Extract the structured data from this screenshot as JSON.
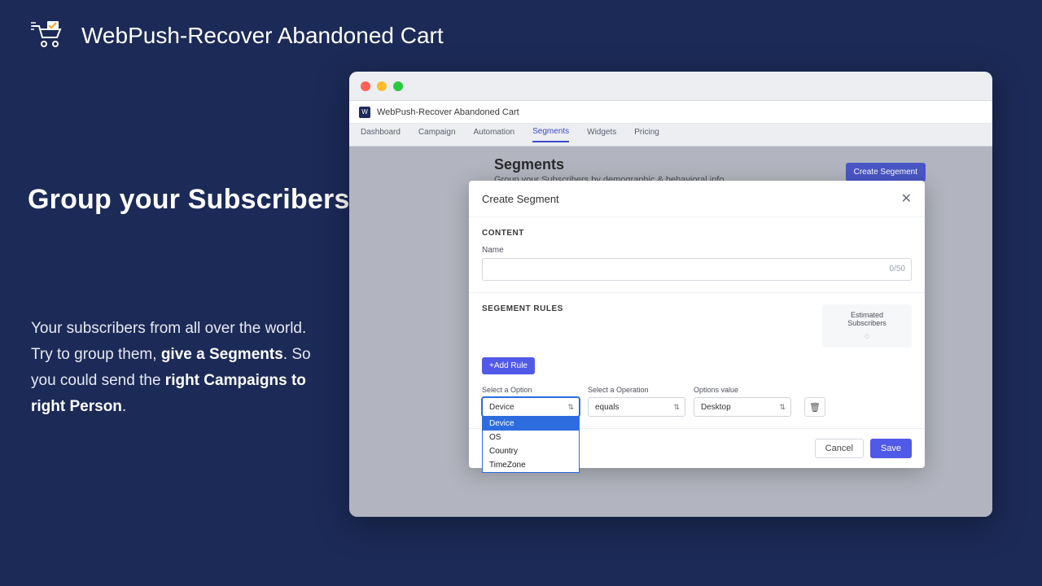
{
  "brand": {
    "title": "WebPush-Recover Abandoned Cart"
  },
  "marketing": {
    "heading": "Group your Subscribers",
    "copy_line1": "Your subscribers from all over the world.",
    "copy_line2_prefix": "Try to group them, ",
    "copy_line2_bold": "give a Segments",
    "copy_line2_suffix": ". So you could send the ",
    "copy_line3_bold": "right Campaigns to right Person",
    "copy_line3_suffix": "."
  },
  "app": {
    "title": "WebPush-Recover Abandoned Cart",
    "tabs": [
      "Dashboard",
      "Campaign",
      "Automation",
      "Segments",
      "Widgets",
      "Pricing"
    ],
    "active_tab_index": 3,
    "page": {
      "heading": "Segments",
      "sub": "Group your Subscribers by demographic & behavioral info",
      "create_btn": "Create Segement"
    }
  },
  "modal": {
    "title": "Create Segment",
    "section_content": "CONTENT",
    "name_label": "Name",
    "name_value": "",
    "char_count": "0/50",
    "section_rules": "SEGEMENT RULES",
    "estimated_label": "Estimated Subscribers",
    "add_rule": "+Add Rule",
    "rule": {
      "opt_label": "Select a Option",
      "opt_value": "Device",
      "opt_options": [
        "Device",
        "OS",
        "Country",
        "TimeZone"
      ],
      "op_label": "Select a Operation",
      "op_value": "equals",
      "val_label": "Options value",
      "val_value": "Desktop"
    },
    "cancel": "Cancel",
    "save": "Save"
  },
  "colors": {
    "brand_bg": "#1c2a57",
    "primary": "#5159e8",
    "accent": "#2d6cdf"
  }
}
